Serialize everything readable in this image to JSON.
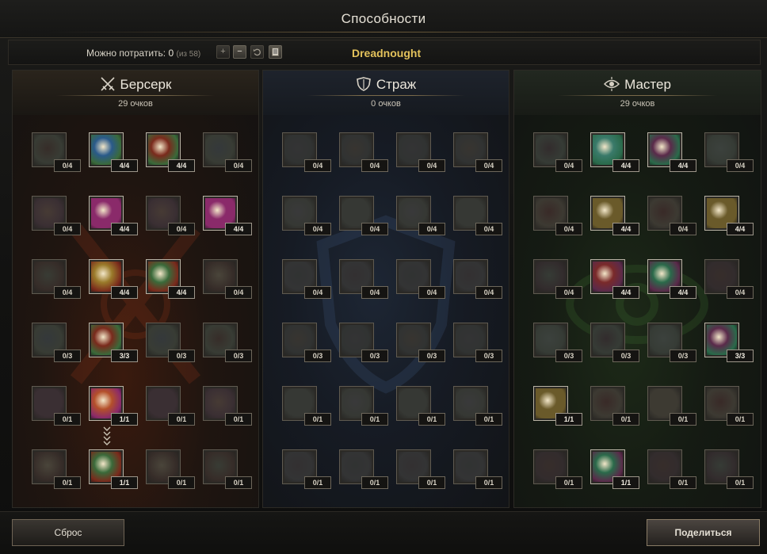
{
  "window": {
    "title": "Способности"
  },
  "points_bar": {
    "label": "Можно потратить:",
    "available": "0",
    "of_text": "(из 58)",
    "class_name": "Dreadnought"
  },
  "trees": [
    {
      "name": "Берсерк",
      "icon": "crossed-swords-icon",
      "points": "29 очков"
    },
    {
      "name": "Страж",
      "icon": "shield-icon",
      "points": "0 очков"
    },
    {
      "name": "Мастер",
      "icon": "eye-icon",
      "points": "29 очков"
    }
  ],
  "skills": [
    [
      "0/4",
      "4/4",
      "4/4",
      "0/4",
      "0/4",
      "4/4",
      "0/4",
      "4/4",
      "0/4",
      "4/4",
      "4/4",
      "0/4",
      "0/3",
      "3/3",
      "0/3",
      "0/3",
      "0/1",
      "1/1",
      "0/1",
      "0/1",
      "0/1",
      "1/1",
      "0/1",
      "0/1"
    ],
    [
      "0/4",
      "0/4",
      "0/4",
      "0/4",
      "0/4",
      "0/4",
      "0/4",
      "0/4",
      "0/4",
      "0/4",
      "0/4",
      "0/4",
      "0/3",
      "0/3",
      "0/3",
      "0/3",
      "0/1",
      "0/1",
      "0/1",
      "0/1",
      "0/1",
      "0/1",
      "0/1",
      "0/1"
    ],
    [
      "0/4",
      "4/4",
      "4/4",
      "0/4",
      "0/4",
      "4/4",
      "0/4",
      "4/4",
      "0/4",
      "4/4",
      "4/4",
      "0/4",
      "0/3",
      "0/3",
      "0/3",
      "3/3",
      "1/1",
      "0/1",
      "0/1",
      "0/1",
      "0/1",
      "1/1",
      "0/1",
      "0/1"
    ]
  ],
  "colors": {
    "class_name": "#e3c25b",
    "berserk_glow": "#3a1a0e",
    "guard_glow": "#1d2634",
    "master_glow": "#1d2a18"
  },
  "buttons": {
    "reset": "Сброс",
    "share": "Поделиться"
  }
}
